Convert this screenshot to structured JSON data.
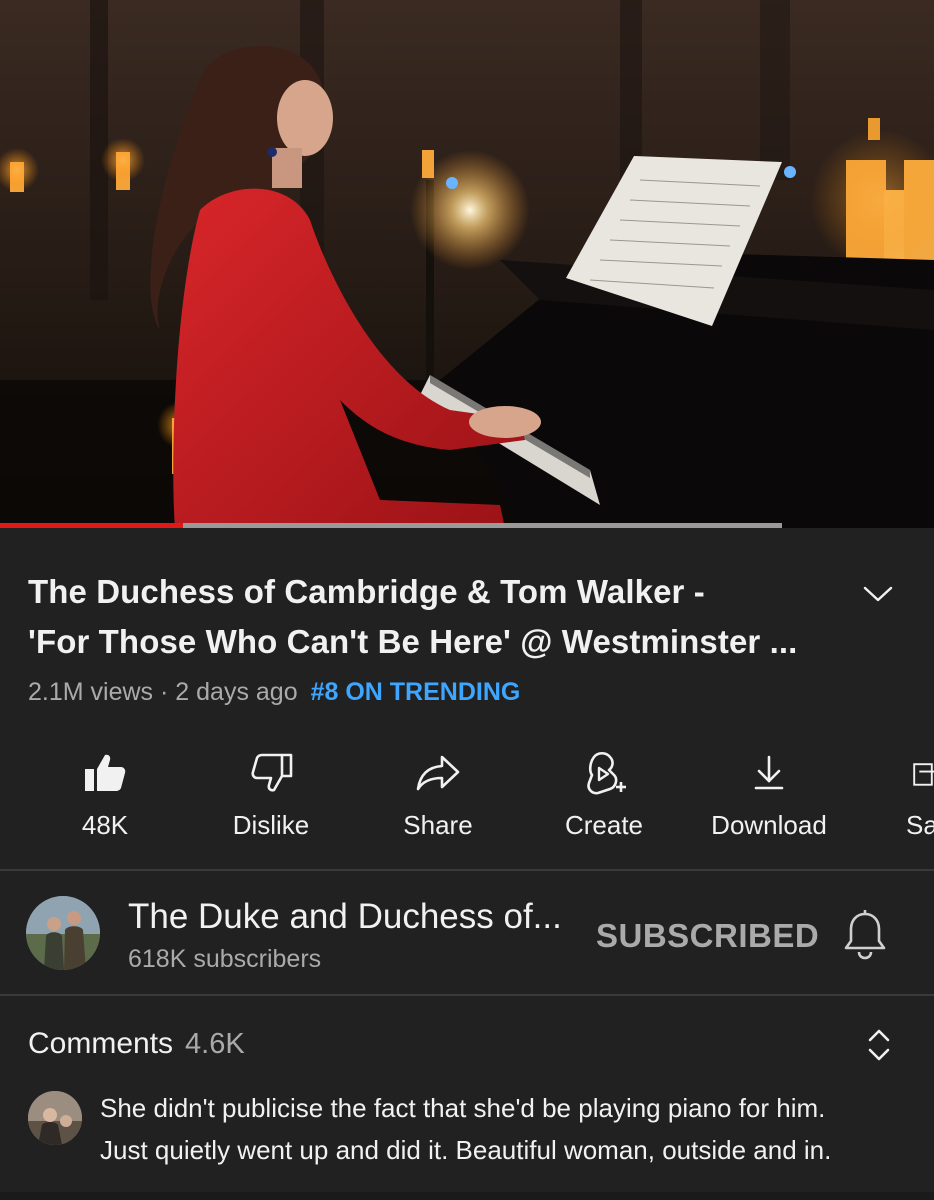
{
  "video": {
    "title_line1": "The Duchess of Cambridge & Tom Walker -",
    "title_line2": "'For Those Who Can't Be Here' @ Westminster ...",
    "views": "2.1M views",
    "separator": "·",
    "age": "2 days ago",
    "trending": "#8 ON TRENDING",
    "progress": 0.196,
    "buffered": 0.837
  },
  "actions": [
    {
      "label": "48K",
      "icon": "like-icon"
    },
    {
      "label": "Dislike",
      "icon": "dislike-icon"
    },
    {
      "label": "Share",
      "icon": "share-icon"
    },
    {
      "label": "Create",
      "icon": "create-icon"
    },
    {
      "label": "Download",
      "icon": "download-icon"
    },
    {
      "label": "Sa",
      "icon": "save-icon"
    }
  ],
  "channel": {
    "name": "The Duke and Duchess of...",
    "subscribers": "618K subscribers",
    "subscribe_label": "SUBSCRIBED"
  },
  "comments": {
    "label": "Comments",
    "count": "4.6K",
    "top_comment_line1": "She didn't publicise the fact that she'd be playing piano for him.",
    "top_comment_line2": "Just quietly went up and did it. Beautiful woman, outside and in."
  },
  "colors": {
    "background": "#212121",
    "accent_red": "#e01818",
    "link_blue": "#3ea6ff",
    "muted_text": "#aaaaaa"
  }
}
